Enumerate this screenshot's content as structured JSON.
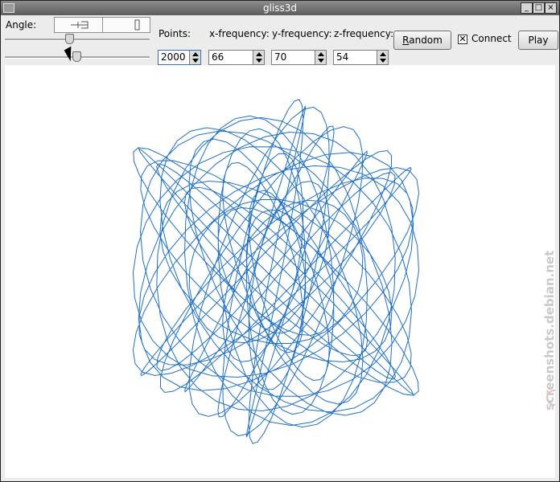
{
  "window": {
    "title": "gliss3d",
    "controls": [
      "_",
      "□",
      "×"
    ]
  },
  "toolbar": {
    "angle_label": "Angle:",
    "points_label": "Points:",
    "xfreq_label": "x-frequency:",
    "yfreq_label": "y-frequency:",
    "zfreq_label": "z-frequency:",
    "random_mnemonic": "R",
    "random_rest": "andom",
    "connect_label": "Connect",
    "connect_checked": "✕",
    "play_label": "Play"
  },
  "spinboxes": {
    "points": "2000",
    "x_frequency": "66",
    "y_frequency": "70",
    "z_frequency": "54"
  },
  "sliders": {
    "angle_upper_fraction": 0.44,
    "angle_lower_fraction": 0.49
  },
  "curve": {
    "stroke_color": "#1f6fc4",
    "samples": 2000,
    "fx": 66,
    "fy": 70,
    "fz": 54
  },
  "watermark": {
    "text": "screenshots.debian.net",
    "color": "#c9c9c9"
  }
}
